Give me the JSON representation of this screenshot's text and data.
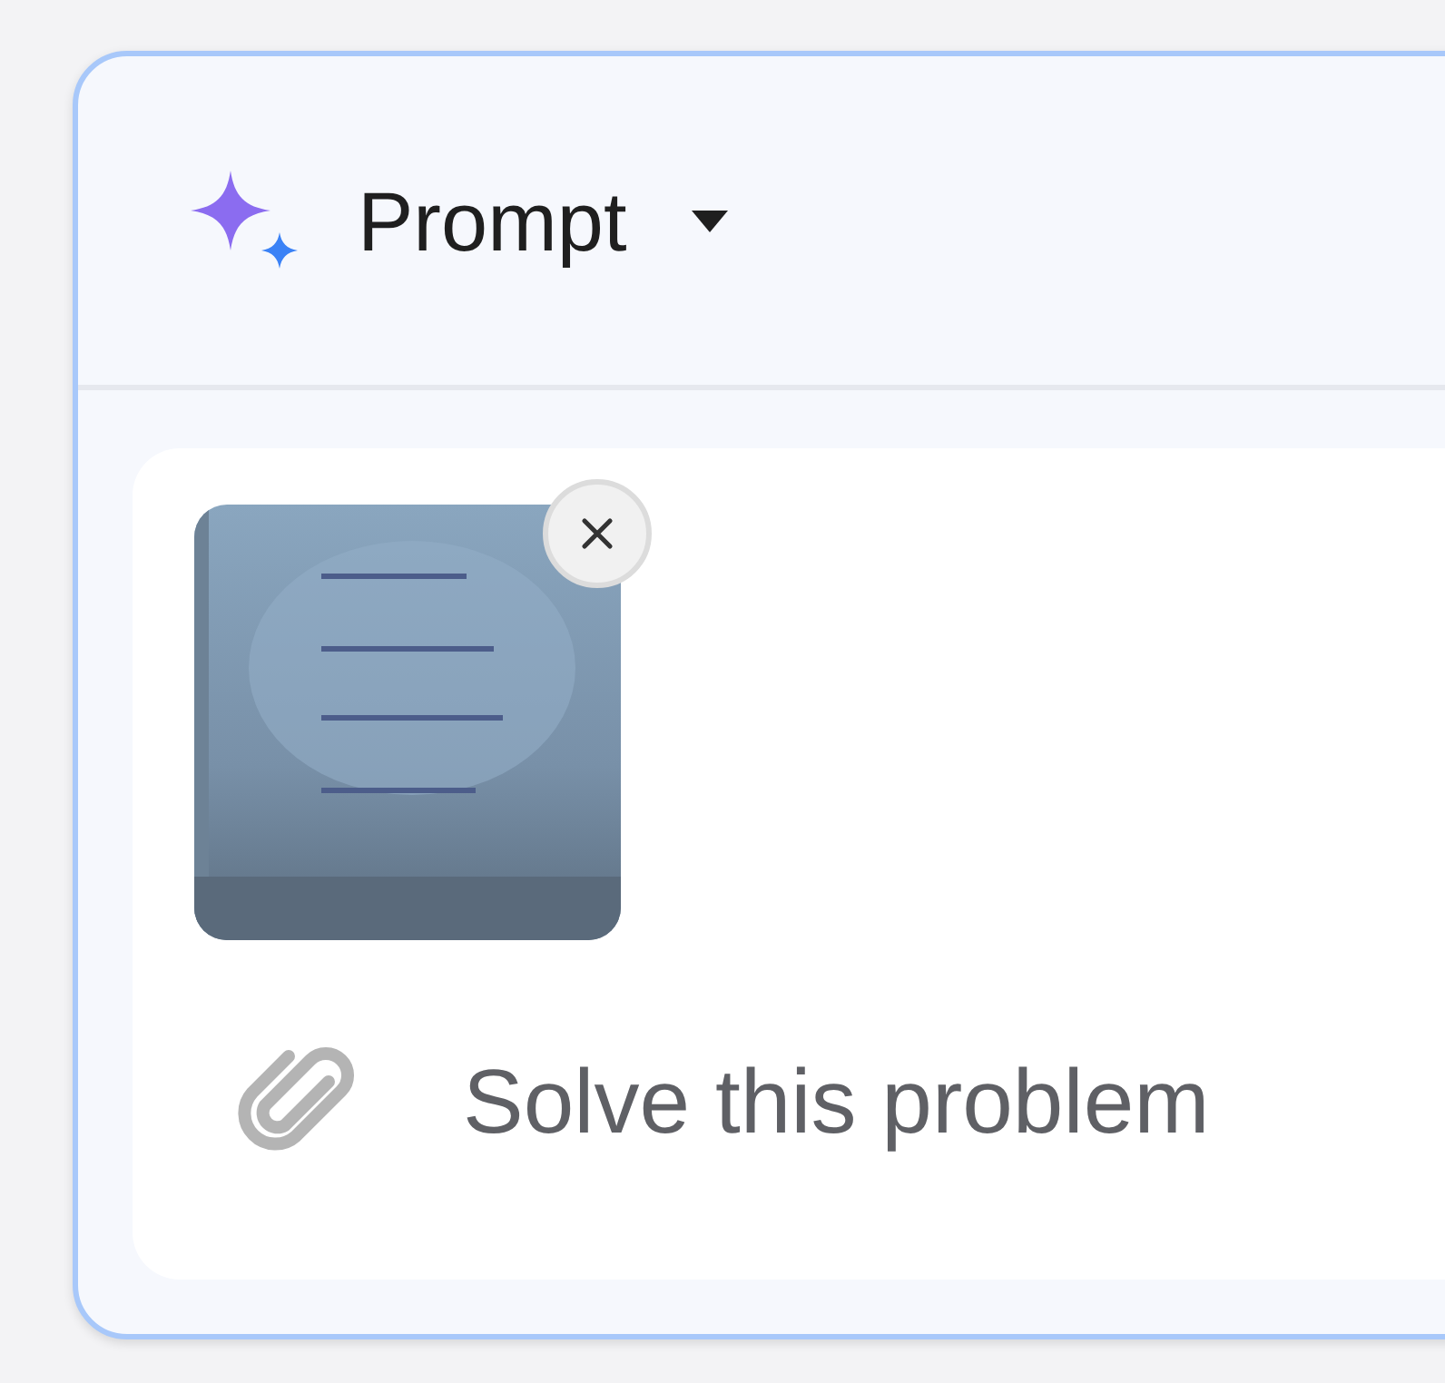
{
  "header": {
    "title": "Prompt"
  },
  "prompt": {
    "text": "Solve this problem"
  }
}
